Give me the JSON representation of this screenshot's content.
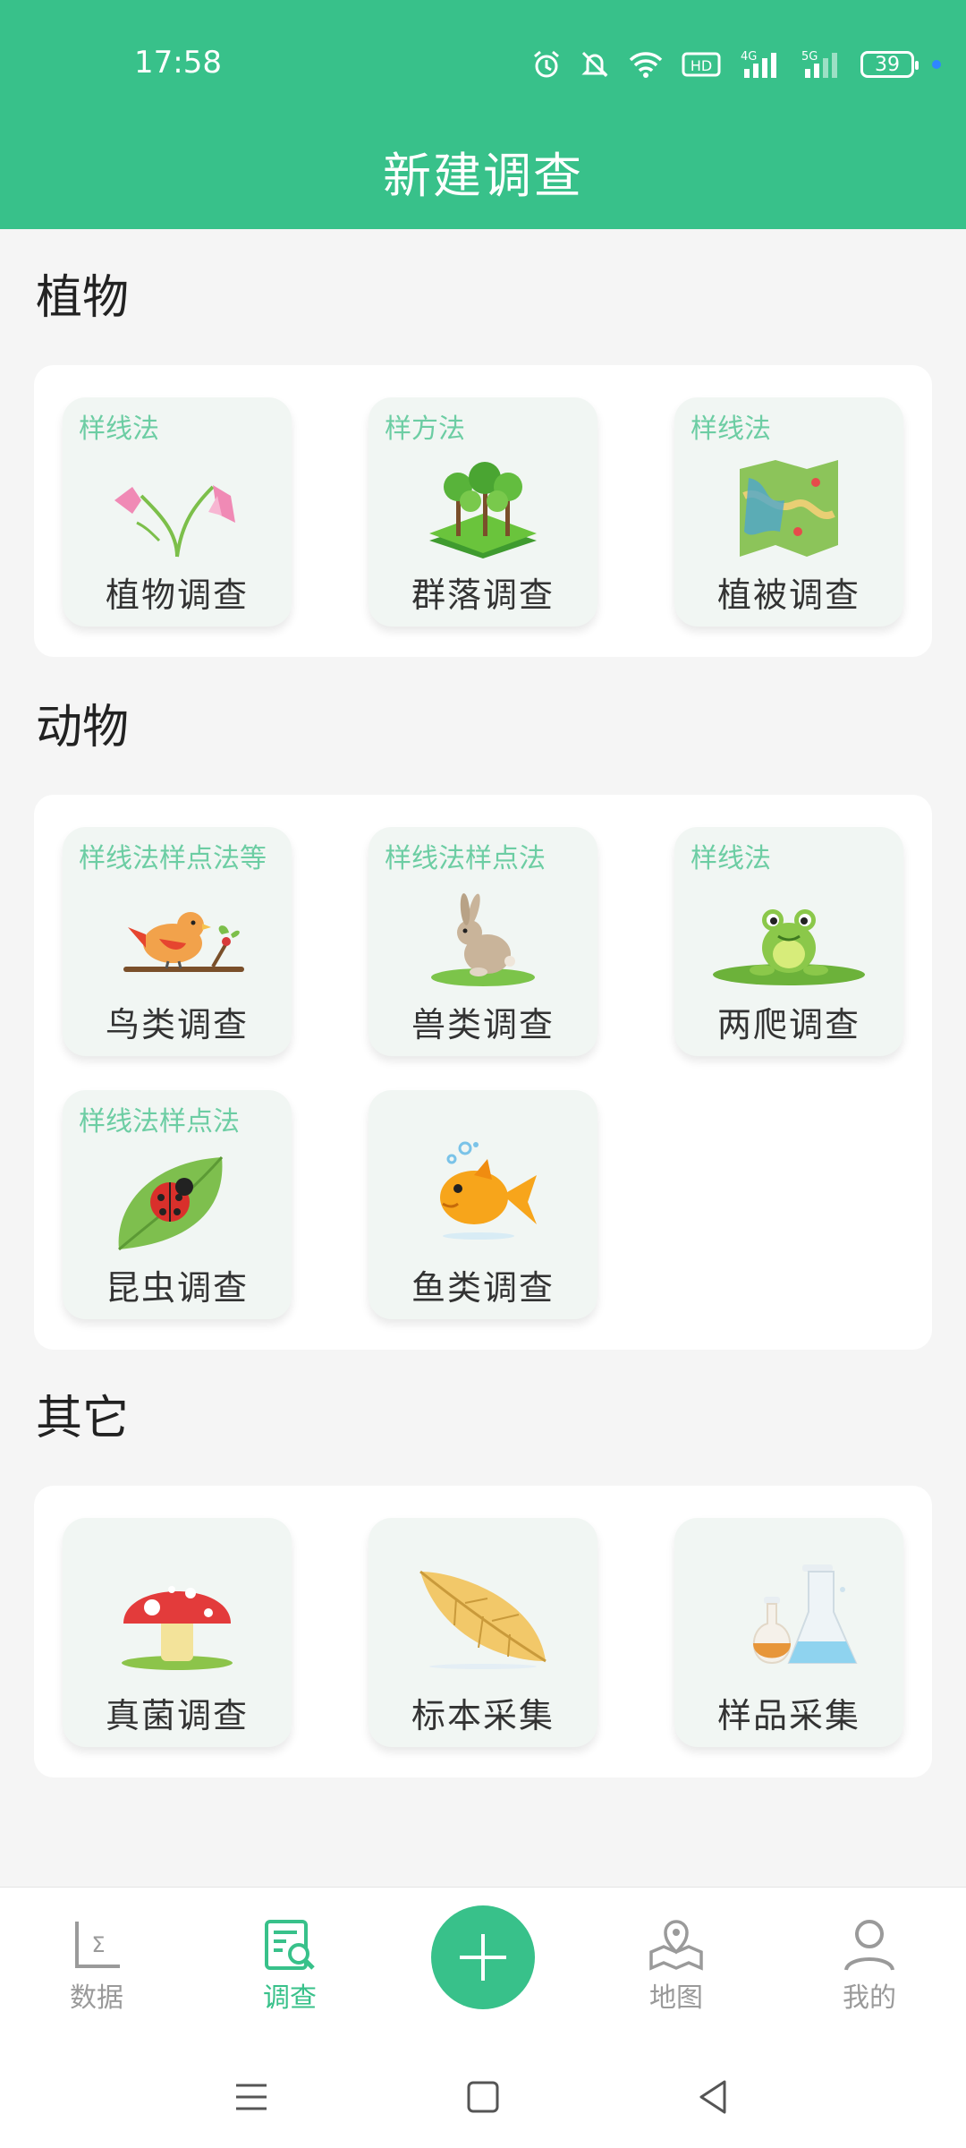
{
  "status": {
    "time": "17:58",
    "battery": "39",
    "network_4g": "4G",
    "network_5g": "5G",
    "hd": "HD"
  },
  "header": {
    "title": "新建调查"
  },
  "sections": [
    {
      "title": "植物",
      "items": [
        {
          "method": "样线法",
          "label": "植物调查",
          "icon": "flower-icon"
        },
        {
          "method": "样方法",
          "label": "群落调查",
          "icon": "forest-icon"
        },
        {
          "method": "样线法",
          "label": "植被调查",
          "icon": "map-icon"
        }
      ]
    },
    {
      "title": "动物",
      "items": [
        {
          "method": "样线法样点法等",
          "label": "鸟类调查",
          "icon": "bird-icon"
        },
        {
          "method": "样线法样点法",
          "label": "兽类调查",
          "icon": "rabbit-icon"
        },
        {
          "method": "样线法",
          "label": "两爬调查",
          "icon": "frog-icon"
        },
        {
          "method": "样线法样点法",
          "label": "昆虫调查",
          "icon": "ladybug-icon"
        },
        {
          "method": "",
          "label": "鱼类调查",
          "icon": "fish-icon"
        }
      ]
    },
    {
      "title": "其它",
      "items": [
        {
          "method": "",
          "label": "真菌调查",
          "icon": "mushroom-icon"
        },
        {
          "method": "",
          "label": "标本采集",
          "icon": "leaf-icon"
        },
        {
          "method": "",
          "label": "样品采集",
          "icon": "flask-icon"
        }
      ]
    }
  ],
  "bottom_nav": [
    {
      "label": "数据",
      "icon": "data-icon",
      "active": false
    },
    {
      "label": "调查",
      "icon": "survey-icon",
      "active": true
    },
    {
      "label": "",
      "icon": "add-icon",
      "active": false
    },
    {
      "label": "地图",
      "icon": "map-pin-icon",
      "active": false
    },
    {
      "label": "我的",
      "icon": "profile-icon",
      "active": false
    }
  ],
  "colors": {
    "primary": "#38c18a",
    "method_text": "#6ccda3",
    "tile_bg": "#f1f6f3"
  }
}
